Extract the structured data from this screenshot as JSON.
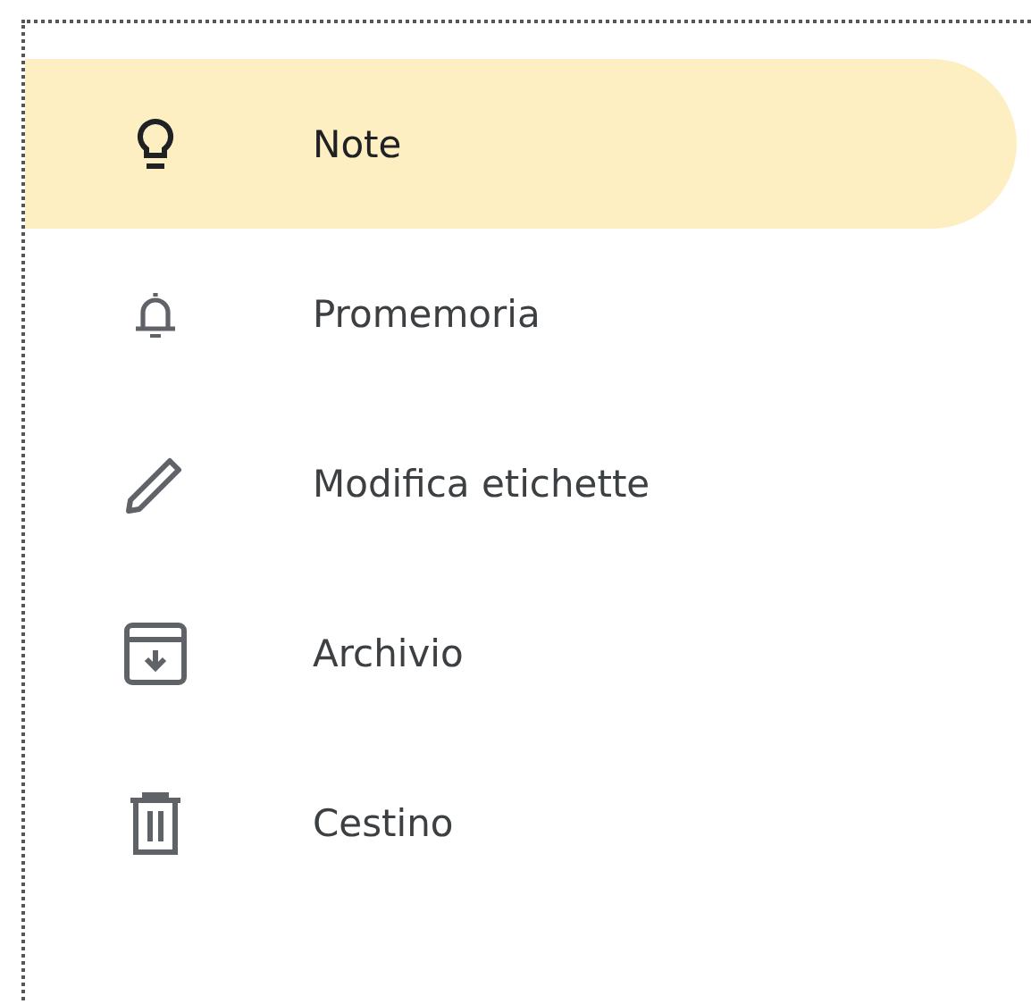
{
  "sidebar": {
    "items": [
      {
        "label": "Note",
        "selected": true
      },
      {
        "label": "Promemoria",
        "selected": false
      },
      {
        "label": "Modifica etichette",
        "selected": false
      },
      {
        "label": "Archivio",
        "selected": false
      },
      {
        "label": "Cestino",
        "selected": false
      }
    ]
  }
}
